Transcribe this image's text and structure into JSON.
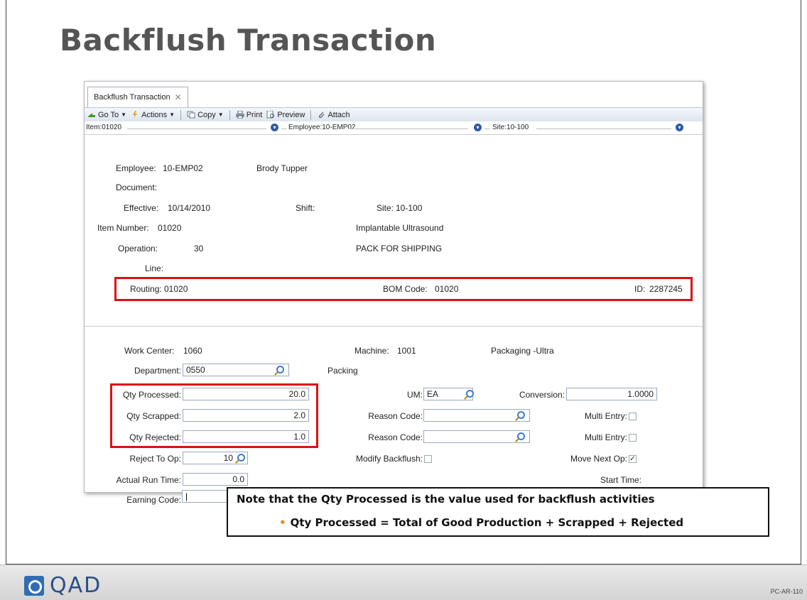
{
  "slide": {
    "title": "Backflush Transaction",
    "logo_text": "QAD",
    "slide_code": "PC-AR-110"
  },
  "window": {
    "tab_label": "Backflush Transaction",
    "toolbar": {
      "goto_label": "Go To",
      "actions_label": "Actions",
      "copy_label": "Copy",
      "print_label": "Print",
      "preview_label": "Preview",
      "attach_label": "Attach"
    },
    "filters": {
      "item": "Item:01020",
      "employee": "Employee:10-EMP02",
      "site": "Site:10-100"
    },
    "header": {
      "employee_label": "Employee:",
      "employee_value": "10-EMP02",
      "employee_name": "Brody Tupper",
      "document_label": "Document:",
      "effective_label": "Effective:",
      "effective_value": "10/14/2010",
      "shift_label": "Shift:",
      "site_label": "Site:",
      "site_value": "10-100",
      "item_number_label": "Item Number:",
      "item_number_value": "01020",
      "item_description": "Implantable Ultrasound",
      "operation_label": "Operation:",
      "operation_value": "30",
      "operation_description": "PACK FOR SHIPPING",
      "line_label": "Line:",
      "routing_label": "Routing:",
      "routing_value": "01020",
      "bom_code_label": "BOM Code:",
      "bom_code_value": "01020",
      "id_label": "ID:",
      "id_value": "2287245"
    },
    "detail": {
      "work_center_label": "Work Center:",
      "work_center_value": "1060",
      "machine_label": "Machine:",
      "machine_value": "1001",
      "machine_description": "Packaging -Ultra",
      "department_label": "Department:",
      "department_value": "0550",
      "department_description": "Packing",
      "qty_processed_label": "Qty Processed:",
      "qty_processed_value": "20.0",
      "um_label": "UM:",
      "um_value": "EA",
      "conversion_label": "Conversion:",
      "conversion_value": "1.0000",
      "qty_scrapped_label": "Qty Scrapped:",
      "qty_scrapped_value": "2.0",
      "reason_code_label": "Reason Code:",
      "multi_entry_label": "Multi Entry:",
      "qty_rejected_label": "Qty Rejected:",
      "qty_rejected_value": "1.0",
      "reject_to_op_label": "Reject To Op:",
      "reject_to_op_value": "10",
      "modify_backflush_label": "Modify Backflush:",
      "move_next_op_label": "Move Next Op:",
      "actual_run_time_label": "Actual Run Time:",
      "actual_run_time_value": "0.0",
      "start_time_label": "Start Time:",
      "earning_code_label": "Earning Code:"
    }
  },
  "note": {
    "line1": "Note that the Qty Processed is the value used for backflush activities",
    "line2": "Qty Processed = Total of Good Production + Scrapped + Rejected"
  },
  "colors": {
    "highlight": "#dd1111",
    "bullet": "#e58b12",
    "brand": "#2f6db5"
  }
}
